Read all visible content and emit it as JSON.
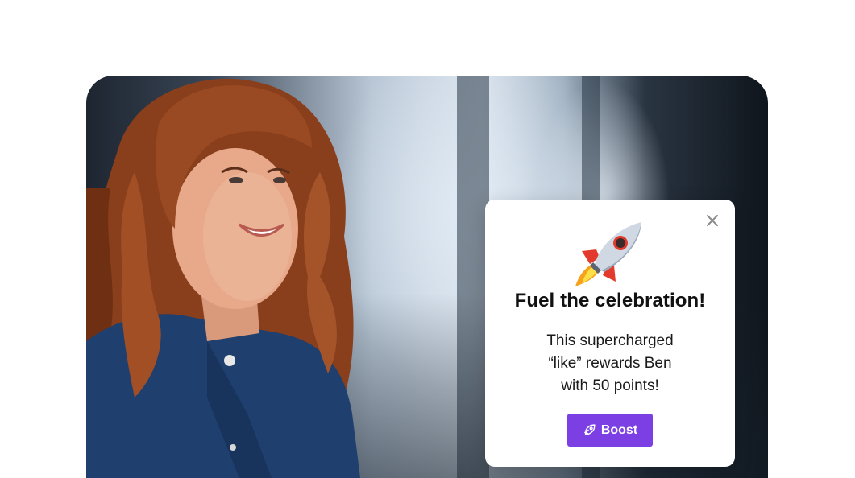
{
  "popup": {
    "title": "Fuel the celebration!",
    "body": "This supercharged\n“like” rewards Ben\nwith 50 points!",
    "button_label": "Boost"
  },
  "colors": {
    "accent": "#7b3fe4",
    "popup_background": "#ffffff"
  },
  "icons": {
    "header": "rocket-emoji",
    "button": "rocket-outline-icon",
    "close": "close-icon"
  }
}
